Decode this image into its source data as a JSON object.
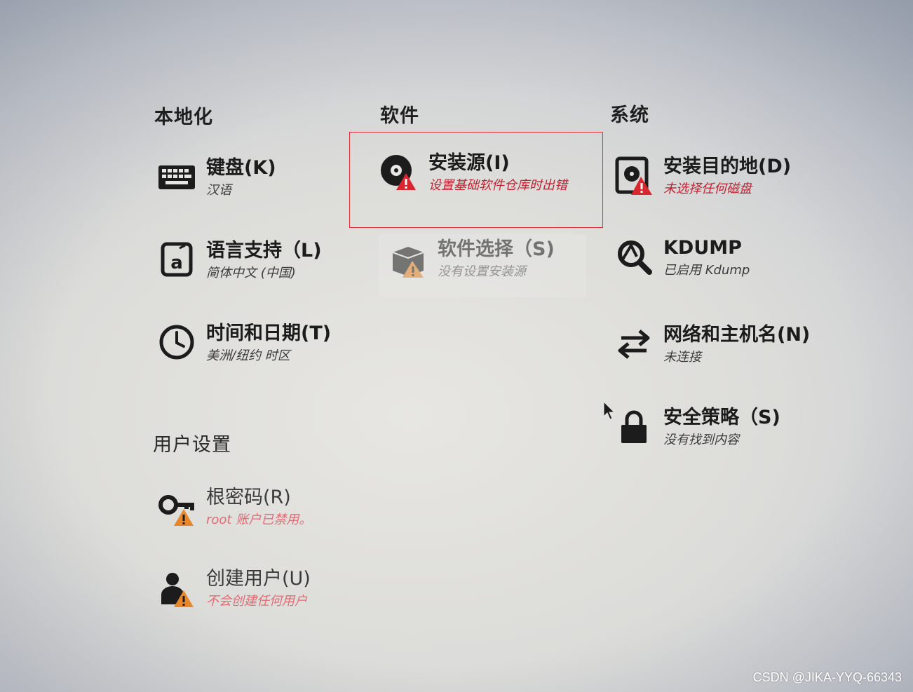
{
  "sections": {
    "localization": "本地化",
    "software": "软件",
    "system": "系统",
    "user_settings": "用户设置"
  },
  "spokes": {
    "keyboard": {
      "title": "键盘(K)",
      "status": "汉语",
      "icon": "keyboard-icon"
    },
    "language": {
      "title": "语言支持（L)",
      "status": "简体中文 (中国)",
      "icon": "language-icon"
    },
    "datetime": {
      "title": "时间和日期(T)",
      "status": "美洲/纽约 时区",
      "icon": "clock-icon"
    },
    "install_source": {
      "title": "安装源(I)",
      "status": "设置基础软件仓库时出错",
      "icon": "disc-warning-icon"
    },
    "software_selection": {
      "title": "软件选择（S)",
      "status": "没有设置安装源",
      "icon": "package-warning-icon"
    },
    "install_destination": {
      "title": "安装目的地(D)",
      "status": "未选择任何磁盘",
      "icon": "harddisk-warning-icon"
    },
    "kdump": {
      "title": "KDUMP",
      "status": "已启用 Kdump",
      "icon": "kdump-search-icon"
    },
    "network": {
      "title": "网络和主机名(N)",
      "status": "未连接",
      "icon": "network-arrows-icon"
    },
    "security": {
      "title": "安全策略（S)",
      "status": "没有找到内容",
      "icon": "lock-icon"
    },
    "root_password": {
      "title": "根密码(R)",
      "status": "root 账户已禁用。",
      "icon": "key-warning-icon"
    },
    "create_user": {
      "title": "创建用户(U)",
      "status": "不会创建任何用户",
      "icon": "user-warning-icon"
    }
  },
  "colors": {
    "error_text": "#c52031",
    "selection_border": "#e0303a",
    "warning_orange": "#e8862a"
  },
  "watermark": "CSDN @JIKA-YYQ-66343"
}
